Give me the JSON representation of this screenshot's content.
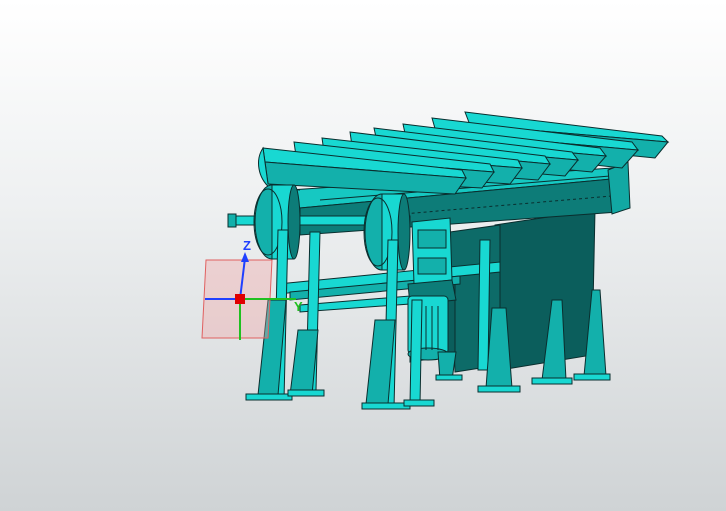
{
  "viewport": {
    "background_top": "#ffffff",
    "background_bottom": "#cfd3d5"
  },
  "model": {
    "name": "conveyor-assembly",
    "body_color": "#18d8d2",
    "shadow_color": "#0b5e5c",
    "edge_color": "#0a2e2e",
    "cleat_count": 9
  },
  "triad": {
    "z_label": "Z",
    "y_label": "Y",
    "x_color": "#2040ff",
    "y_color": "#20c020",
    "z_color": "#2040ff",
    "origin_color": "#e00000",
    "plane_color": "#f4a0a0"
  }
}
